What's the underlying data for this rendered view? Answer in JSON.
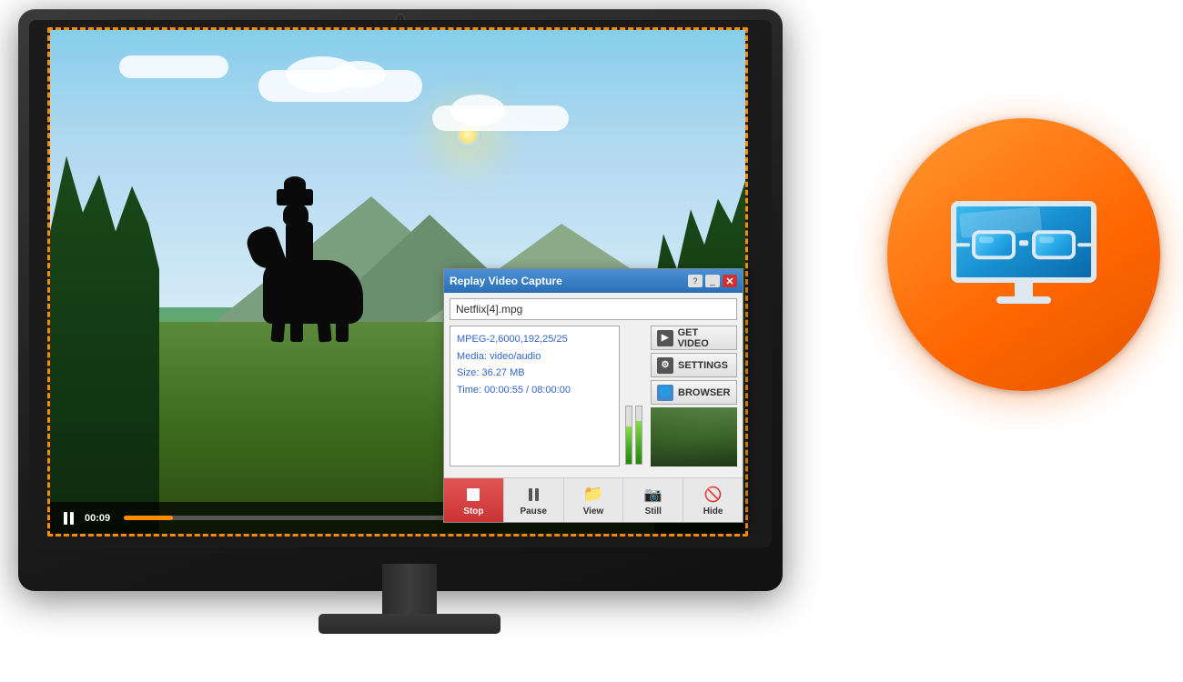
{
  "monitor": {
    "camera_label": "camera"
  },
  "video": {
    "time": "00:09",
    "progress_percent": 8
  },
  "dialog": {
    "title": "Replay Video Capture",
    "filename": "Netflix[4].mpg",
    "info_line1": "MPEG-2,6000,192,25/25",
    "info_line2": "Media: video/audio",
    "info_line3": "Size: 36.27  MB",
    "info_line4": "Time: 00:00:55  / 08:00:00",
    "meter1_height": "65%",
    "meter2_height": "75%",
    "btn_get_video": "GET VIDEO",
    "btn_settings": "SETTINGS",
    "btn_browser": "BROWSER",
    "toolbar": {
      "stop": "Stop",
      "pause": "Pause",
      "view": "View",
      "still": "Still",
      "hide": "Hide"
    },
    "title_btns": {
      "help": "?",
      "minimize": "_",
      "close": "✕"
    }
  },
  "app_logo": {
    "alt": "Replay Video Capture App Icon"
  }
}
